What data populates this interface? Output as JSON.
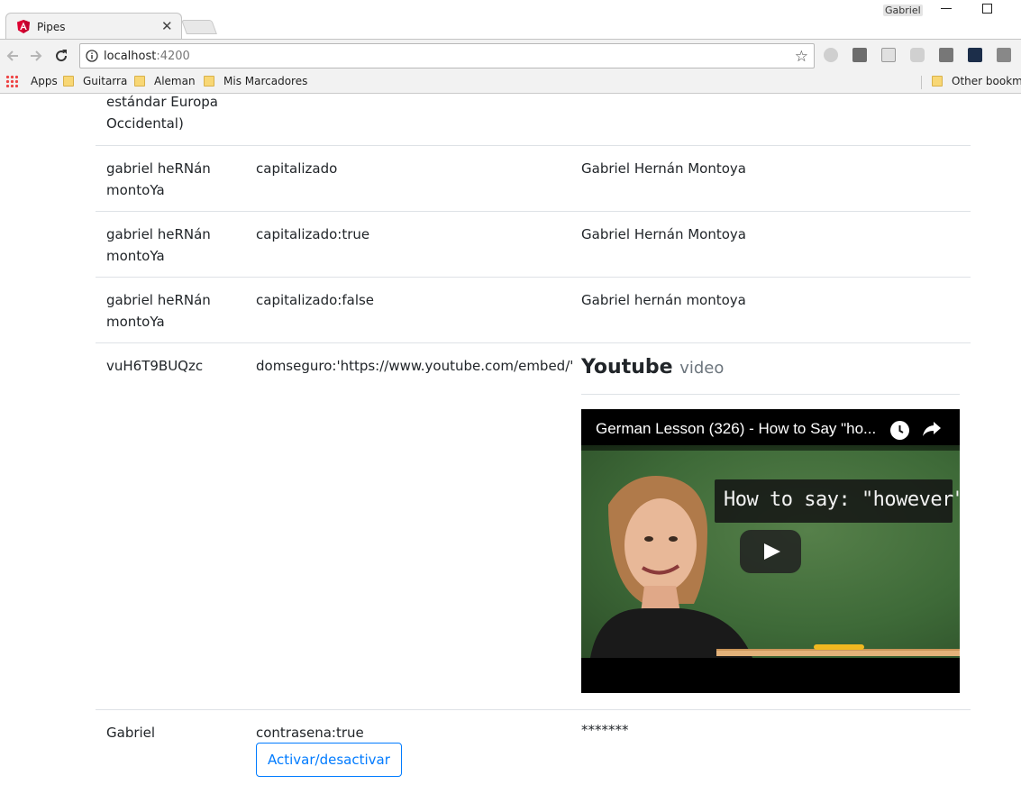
{
  "browser": {
    "tab_title": "Pipes",
    "profile_name": "Gabriel",
    "url_host": "localhost",
    "url_port": ":4200",
    "bookmarks": [
      {
        "label": "Apps"
      },
      {
        "label": "Guitarra"
      },
      {
        "label": "Aleman"
      },
      {
        "label": "Mis Marcadores"
      }
    ],
    "other_bookmarks": "Other bookma"
  },
  "table": {
    "rows": [
      {
        "value": "estándar Europa Occidental)",
        "pipe": "",
        "result": ""
      },
      {
        "value": "gabriel heRNán montoYa",
        "pipe": "capitalizado",
        "result": "Gabriel Hernán Montoya"
      },
      {
        "value": "gabriel heRNán montoYa",
        "pipe": "capitalizado:true",
        "result": "Gabriel Hernán Montoya"
      },
      {
        "value": "gabriel heRNán montoYa",
        "pipe": "capitalizado:false",
        "result": "Gabriel hernán montoya"
      },
      {
        "value": "vuH6T9BUQzc",
        "pipe": "domseguro:'https://www.youtube.com/embed/'",
        "result": ""
      },
      {
        "value": "Gabriel",
        "pipe": "contrasena:true",
        "result": "*******"
      }
    ]
  },
  "youtube": {
    "heading": "Youtube",
    "heading_small": "video",
    "video_title": "German Lesson (326) - How to Say \"ho...",
    "caption": "How to say: \"however\""
  },
  "toggle_button_label": "Activar/desactivar",
  "colors": {
    "primary": "#007bff",
    "border": "#dee2e6",
    "angular_red": "#dd0031"
  }
}
